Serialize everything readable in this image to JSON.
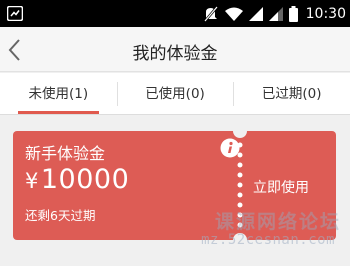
{
  "status_bar": {
    "time": "10:30",
    "icons": [
      "notification-icon",
      "mute-icon",
      "wifi-icon",
      "signal-icon",
      "signal-icon",
      "battery-icon"
    ]
  },
  "header": {
    "title": "我的体验金",
    "back_icon": "chevron-left-icon"
  },
  "tabs": [
    {
      "label": "未使用(1)",
      "active": true
    },
    {
      "label": "已使用(0)",
      "active": false
    },
    {
      "label": "已过期(0)",
      "active": false
    }
  ],
  "coupon": {
    "name": "新手体验金",
    "currency": "¥",
    "amount": "10000",
    "expire_text": "还剩6天过期",
    "action_label": "立即使用",
    "info_icon": "info-icon",
    "background_color": "#dd5c55"
  },
  "watermark": {
    "text": "课源网络论坛",
    "url": "mz.52cesnan.com"
  },
  "colors": {
    "accent": "#e05a4e",
    "status_bar": "#000000"
  }
}
